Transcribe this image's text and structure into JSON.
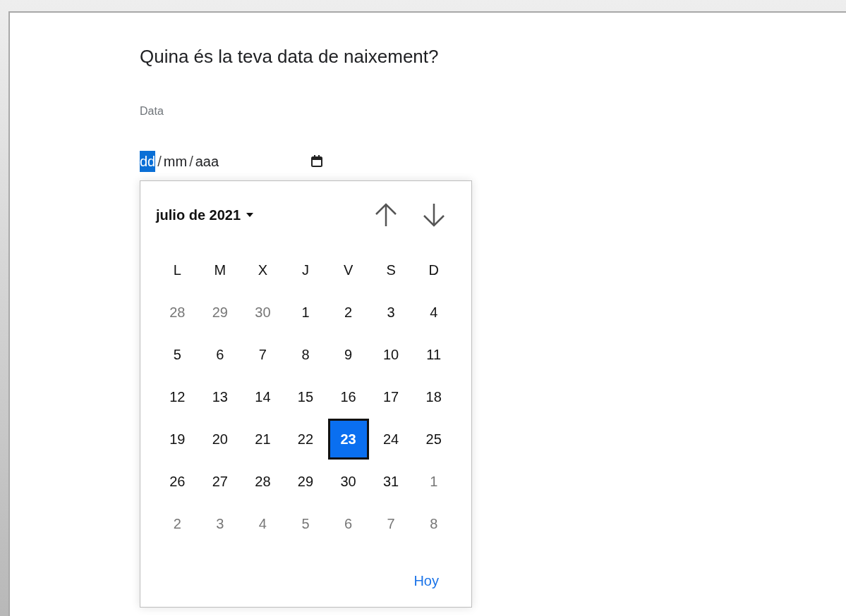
{
  "question": "Quina és la teva data de naixement?",
  "field_label": "Data",
  "date_field": {
    "segments": [
      {
        "text": "dd",
        "selected": true
      },
      {
        "text": "mm",
        "selected": false
      },
      {
        "text": "aaa",
        "selected": false
      }
    ],
    "separators": [
      "/",
      "/"
    ]
  },
  "calendar": {
    "month_label": "julio de 2021",
    "weekdays": [
      "L",
      "M",
      "X",
      "J",
      "V",
      "S",
      "D"
    ],
    "weeks": [
      [
        {
          "text": "28",
          "outside": true,
          "selected": false
        },
        {
          "text": "29",
          "outside": true,
          "selected": false
        },
        {
          "text": "30",
          "outside": true,
          "selected": false
        },
        {
          "text": "1",
          "outside": false,
          "selected": false
        },
        {
          "text": "2",
          "outside": false,
          "selected": false
        },
        {
          "text": "3",
          "outside": false,
          "selected": false
        },
        {
          "text": "4",
          "outside": false,
          "selected": false
        }
      ],
      [
        {
          "text": "5",
          "outside": false,
          "selected": false
        },
        {
          "text": "6",
          "outside": false,
          "selected": false
        },
        {
          "text": "7",
          "outside": false,
          "selected": false
        },
        {
          "text": "8",
          "outside": false,
          "selected": false
        },
        {
          "text": "9",
          "outside": false,
          "selected": false
        },
        {
          "text": "10",
          "outside": false,
          "selected": false
        },
        {
          "text": "11",
          "outside": false,
          "selected": false
        }
      ],
      [
        {
          "text": "12",
          "outside": false,
          "selected": false
        },
        {
          "text": "13",
          "outside": false,
          "selected": false
        },
        {
          "text": "14",
          "outside": false,
          "selected": false
        },
        {
          "text": "15",
          "outside": false,
          "selected": false
        },
        {
          "text": "16",
          "outside": false,
          "selected": false
        },
        {
          "text": "17",
          "outside": false,
          "selected": false
        },
        {
          "text": "18",
          "outside": false,
          "selected": false
        }
      ],
      [
        {
          "text": "19",
          "outside": false,
          "selected": false
        },
        {
          "text": "20",
          "outside": false,
          "selected": false
        },
        {
          "text": "21",
          "outside": false,
          "selected": false
        },
        {
          "text": "22",
          "outside": false,
          "selected": false
        },
        {
          "text": "23",
          "outside": false,
          "selected": true
        },
        {
          "text": "24",
          "outside": false,
          "selected": false
        },
        {
          "text": "25",
          "outside": false,
          "selected": false
        }
      ],
      [
        {
          "text": "26",
          "outside": false,
          "selected": false
        },
        {
          "text": "27",
          "outside": false,
          "selected": false
        },
        {
          "text": "28",
          "outside": false,
          "selected": false
        },
        {
          "text": "29",
          "outside": false,
          "selected": false
        },
        {
          "text": "30",
          "outside": false,
          "selected": false
        },
        {
          "text": "31",
          "outside": false,
          "selected": false
        },
        {
          "text": "1",
          "outside": true,
          "selected": false
        }
      ],
      [
        {
          "text": "2",
          "outside": true,
          "selected": false
        },
        {
          "text": "3",
          "outside": true,
          "selected": false
        },
        {
          "text": "4",
          "outside": true,
          "selected": false
        },
        {
          "text": "5",
          "outside": true,
          "selected": false
        },
        {
          "text": "6",
          "outside": true,
          "selected": false
        },
        {
          "text": "7",
          "outside": true,
          "selected": false
        },
        {
          "text": "8",
          "outside": true,
          "selected": false
        }
      ]
    ],
    "today_link": "Hoy"
  }
}
